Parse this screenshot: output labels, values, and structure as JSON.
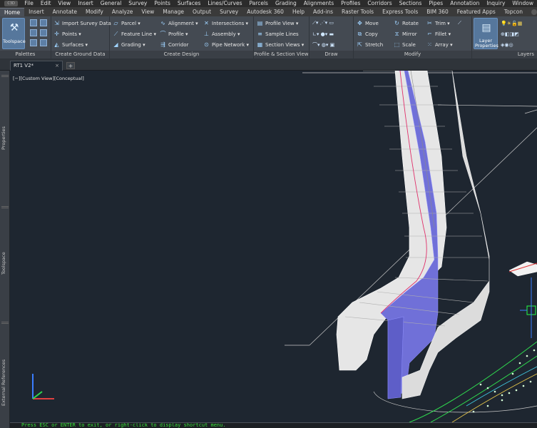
{
  "menubar": {
    "logo": "C3D",
    "items": [
      "File",
      "Edit",
      "View",
      "Insert",
      "General",
      "Survey",
      "Points",
      "Surfaces",
      "Lines/Curves",
      "Parcels",
      "Grading",
      "Alignments",
      "Profiles",
      "Corridors",
      "Sections",
      "Pipes",
      "Annotation",
      "Inquiry",
      "Window"
    ]
  },
  "ribbon_tabs": [
    "Home",
    "Insert",
    "Annotate",
    "Modify",
    "Analyze",
    "View",
    "Manage",
    "Output",
    "Survey",
    "Autodesk 360",
    "Help",
    "Add-ins",
    "Raster Tools",
    "Express Tools",
    "BIM 360",
    "Featured Apps",
    "Topcon"
  ],
  "ribbon": {
    "palettes": {
      "title": "Palettes",
      "toolspace": "Toolspace"
    },
    "ground": {
      "title": "Create Ground Data",
      "import_survey": "Import Survey Data",
      "points": "Points",
      "surfaces": "Surfaces"
    },
    "design": {
      "title": "Create Design",
      "parcel": "Parcel",
      "feature_line": "Feature Line",
      "grading": "Grading",
      "alignment": "Alignment",
      "profile": "Profile",
      "corridor": "Corridor",
      "intersections": "Intersections",
      "assembly": "Assembly",
      "pipe_network": "Pipe Network"
    },
    "profile_section": {
      "title": "Profile & Section Views",
      "profile_view": "Profile View",
      "sample_lines": "Sample Lines",
      "section_views": "Section Views"
    },
    "draw": {
      "title": "Draw"
    },
    "modify": {
      "title": "Modify",
      "move": "Move",
      "copy": "Copy",
      "stretch": "Stretch",
      "rotate": "Rotate",
      "mirror": "Mirror",
      "scale": "Scale",
      "trim": "Trim",
      "fillet": "Fillet",
      "array": "Array"
    },
    "layers": {
      "title": "Layers",
      "layer_properties": "Layer Properties"
    }
  },
  "document_tab": {
    "name": "RT1 V2*",
    "close": "×",
    "new": "+"
  },
  "side_palettes": [
    "Properties",
    "Toolspace",
    "External References"
  ],
  "viewport": {
    "label": "[−][Custom View][Conceptual]"
  },
  "command_line": {
    "text": "Press ESC or ENTER to exit, or right-click to display shortcut menu."
  },
  "colors": {
    "background": "#1e2630",
    "ribbon": "#444a52",
    "wall": "#e8e8e8",
    "ditch": "#7070d8",
    "command_text": "#38e03a"
  }
}
